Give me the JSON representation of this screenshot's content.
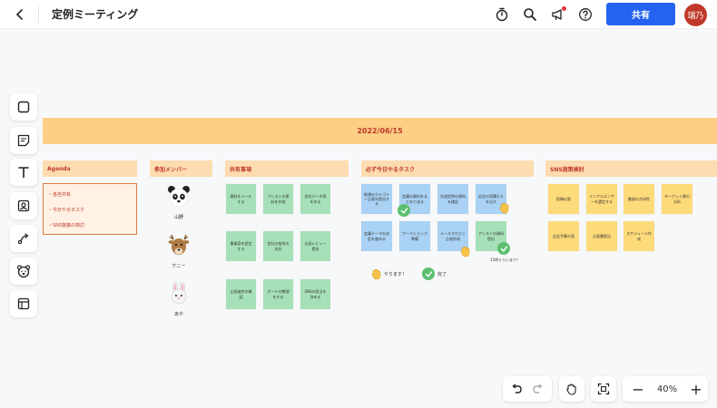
{
  "header": {
    "title": "定例ミーティング",
    "share_label": "共有",
    "avatar_text": "瑞乃"
  },
  "board": {
    "date": "2022/06/15",
    "sections": {
      "agenda": "Agenda",
      "members": "参加メンバー",
      "shared": "共有事項",
      "today": "必ず今日やるタスク",
      "sns": "SNS施策検討"
    },
    "agenda_items": [
      "・各自共有",
      "・今日やるタスク",
      "・SNS施策の検討"
    ],
    "members": [
      "山野",
      "ケニー",
      "あや"
    ],
    "shared_notes": [
      "資料をメールする",
      "アレストの資料を作成",
      "会社データ案を作る",
      "事業案を設定する",
      "会社の各所の対応",
      "企画レビュー提出",
      "企画進捗の確認",
      "ボードの整理をする",
      "SNSの担当を決める"
    ],
    "today_notes": [
      "新規のカテゴリー企画を提出する",
      "会議の資料をまとめて送る",
      "先週定例の資料を確認",
      "広告の見積もりを出す",
      "会議テーマの決定を進める",
      "ワークショップ準備",
      "メールマガジン企画作成",
      "アレストの資料提出"
    ],
    "sns_notes": [
      "投稿の案",
      "インフルエンサーを選定する",
      "動画の方向性",
      "ターゲット層の分析",
      "広告予算の案",
      "企画書提出",
      "スケジュール作成"
    ],
    "legend": {
      "doing": "やります！",
      "done": "完了"
    },
    "due_note": "15時ぐらいまで！"
  },
  "zoom": {
    "level": "40%",
    "minus": "−",
    "plus": "+"
  },
  "colors": {
    "accent": "#2463f0",
    "banner": "#fcce86",
    "header_text": "#c0392b",
    "sticky_green": "#a6e0b8",
    "sticky_blue": "#a9d2f4",
    "sticky_yellow": "#fdda7a"
  },
  "icons": {
    "back": "chevron-left-icon",
    "timer": "timer-icon",
    "search": "search-icon",
    "announce": "megaphone-icon",
    "help": "help-icon",
    "tools": [
      "square-icon",
      "sticky-note-icon",
      "text-icon",
      "image-icon",
      "connector-icon",
      "bear-icon",
      "template-icon"
    ]
  }
}
